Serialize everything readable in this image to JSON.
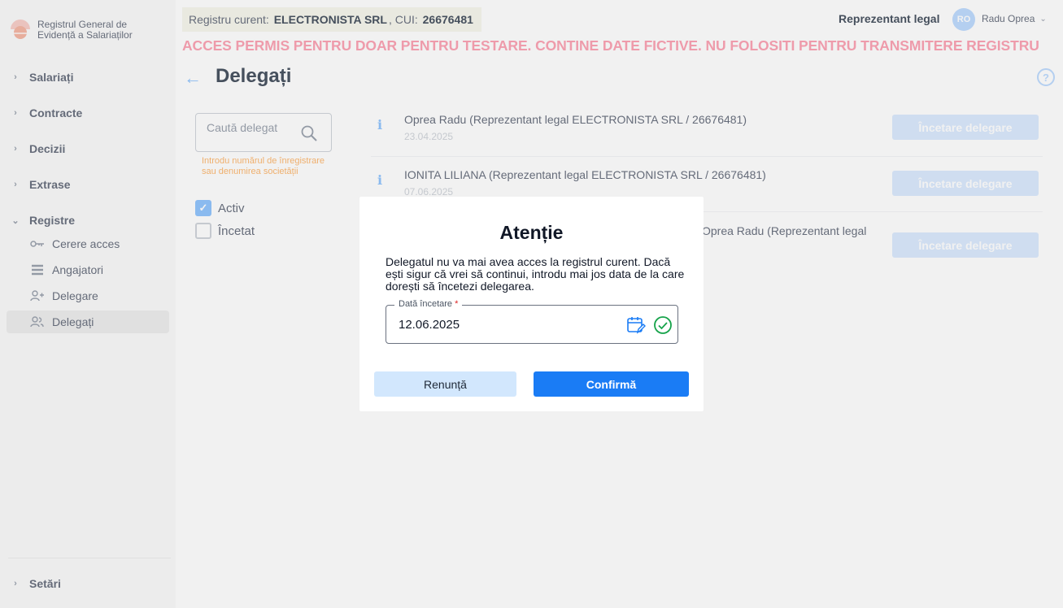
{
  "app": {
    "name": "Registrul General de Evidență a Salariaților"
  },
  "sidebar": {
    "items": [
      {
        "label": "Salariați"
      },
      {
        "label": "Contracte"
      },
      {
        "label": "Decizii"
      },
      {
        "label": "Extrase"
      },
      {
        "label": "Registre"
      }
    ],
    "registre_items": [
      {
        "label": "Cerere acces",
        "icon": "key-icon"
      },
      {
        "label": "Angajatori",
        "icon": "list-icon"
      },
      {
        "label": "Delegare",
        "icon": "user-add-icon"
      },
      {
        "label": "Delegați",
        "icon": "users-icon"
      }
    ],
    "settings_label": "Setări"
  },
  "header": {
    "registry_prefix": "Registru curent:",
    "company": "ELECTRONISTA SRL",
    "cui_label": ", CUI:",
    "cui": "26676481",
    "role": "Reprezentant legal",
    "avatar_initials": "RO",
    "user_name": "Radu Oprea",
    "warning": "ACCES PERMIS PENTRU DOAR PENTRU TESTARE. CONTINE DATE FICTIVE. NU FOLOSITI PENTRU TRANSMITERE REGISTRU"
  },
  "page": {
    "title": "Delegați",
    "help": "?"
  },
  "filters": {
    "search_placeholder": "Caută delegat",
    "search_hint": "Introdu numărul de înregistrare sau denumirea societății",
    "status_active": "Activ",
    "status_ended": "Încetat"
  },
  "delegates": [
    {
      "name": "Oprea Radu (Reprezentant legal ELECTRONISTA SRL / 26676481)",
      "date": "23.04.2025",
      "action": "Încetare delegare"
    },
    {
      "name": "IONITA LILIANA (Reprezentant legal ELECTRONISTA SRL / 26676481)",
      "date": "07.06.2025",
      "action": "Încetare delegare"
    },
    {
      "name": "Oprea Radu (Reprezentant legal",
      "date": "",
      "action": "Încetare delegare"
    }
  ],
  "dialog": {
    "title": "Atenție",
    "message": "Delegatul nu va mai avea acces la registrul curent. Dacă ești sigur că vrei să continui, introdu mai jos data de la care dorești să încetezi delegarea.",
    "date_label": "Dată încetare",
    "date_required": "*",
    "date_value": "12.06.2025",
    "cancel_label": "Renunță",
    "confirm_label": "Confirmă"
  },
  "colors": {
    "primary": "#1a7cf5",
    "primary_light": "#d2e7fd",
    "success": "#16a34a",
    "warning_text": "#f43f5e"
  }
}
